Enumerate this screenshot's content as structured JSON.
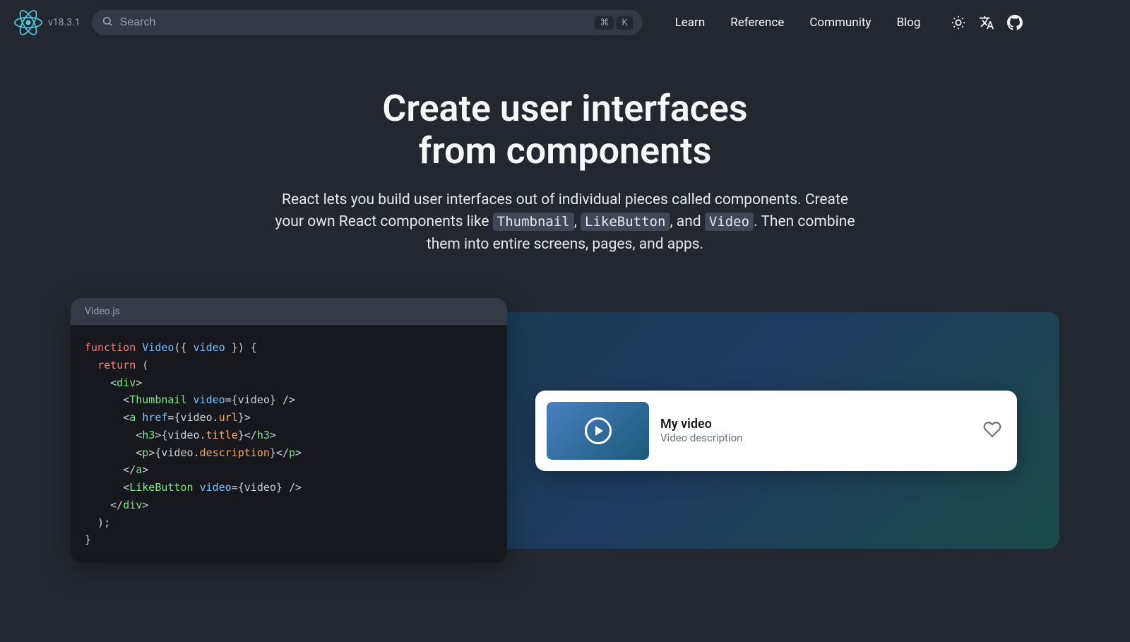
{
  "header": {
    "version": "v18.3.1",
    "search_placeholder": "Search",
    "shortcut_cmd": "⌘",
    "shortcut_key": "K",
    "nav": [
      "Learn",
      "Reference",
      "Community",
      "Blog"
    ]
  },
  "hero": {
    "title_line1": "Create user interfaces",
    "title_line2": "from components",
    "desc_part1": "React lets you build user interfaces out of individual pieces called components. Create your own React components like ",
    "code1": "Thumbnail",
    "desc_part2": ", ",
    "code2": "LikeButton",
    "desc_part3": ", and ",
    "code3": "Video",
    "desc_part4": ". Then combine them into entire screens, pages, and apps."
  },
  "code": {
    "filename": "Video.js",
    "l1_kw": "function",
    "l1_fn": "Video",
    "l1_rest": "({ ",
    "l1_arg": "video",
    "l1_end": " }) {",
    "l2_kw": "return",
    "l2_end": " (",
    "l3_open": "<",
    "l3_tag": "div",
    "l3_close": ">",
    "l4_open": "<",
    "l4_comp": "Thumbnail",
    "l4_sp": " ",
    "l4_attr": "video",
    "l4_eq": "=",
    "l4_val": "{video}",
    "l4_close": " />",
    "l5_open": "<",
    "l5_tag": "a",
    "l5_sp": " ",
    "l5_attr": "href",
    "l5_eq": "=",
    "l5_val1": "{video.",
    "l5_prop": "url",
    "l5_val2": "}",
    "l5_close": ">",
    "l6_open": "<",
    "l6_tag": "h3",
    "l6_mid": ">",
    "l6_val1": "{video.",
    "l6_prop": "title",
    "l6_val2": "}",
    "l6_close1": "</",
    "l6_close2": ">",
    "l7_open": "<",
    "l7_tag": "p",
    "l7_mid": ">",
    "l7_val1": "{video.",
    "l7_prop": "description",
    "l7_val2": "}",
    "l7_close1": "</",
    "l7_close2": ">",
    "l8_open": "</",
    "l8_tag": "a",
    "l8_close": ">",
    "l9_open": "<",
    "l9_comp": "LikeButton",
    "l9_sp": " ",
    "l9_attr": "video",
    "l9_eq": "=",
    "l9_val": "{video}",
    "l9_close": " />",
    "l10_open": "</",
    "l10_tag": "div",
    "l10_close": ">",
    "l11": "  );",
    "l12": "}"
  },
  "preview": {
    "video_title": "My video",
    "video_desc": "Video description"
  }
}
